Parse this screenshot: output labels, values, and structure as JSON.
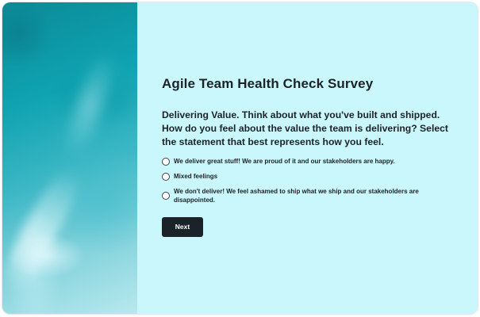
{
  "survey": {
    "title": "Agile Team Health Check Survey",
    "question": "Delivering Value. Think about what you've built and shipped. How do you feel about the value the team is delivering? Select the statement that best represents how you feel.",
    "options": [
      {
        "label": "We deliver great stuff! We are proud of it and our stakeholders are happy."
      },
      {
        "label": "Mixed feelings"
      },
      {
        "label": "We don't deliver! We feel ashamed to ship what we ship and our stakeholders are disappointed."
      }
    ],
    "next_label": "Next"
  },
  "colors": {
    "panel_background": "#c9f7fc",
    "text": "#1b2328",
    "button_background": "#1b2328",
    "hero_accent": "#0fa3b1"
  }
}
